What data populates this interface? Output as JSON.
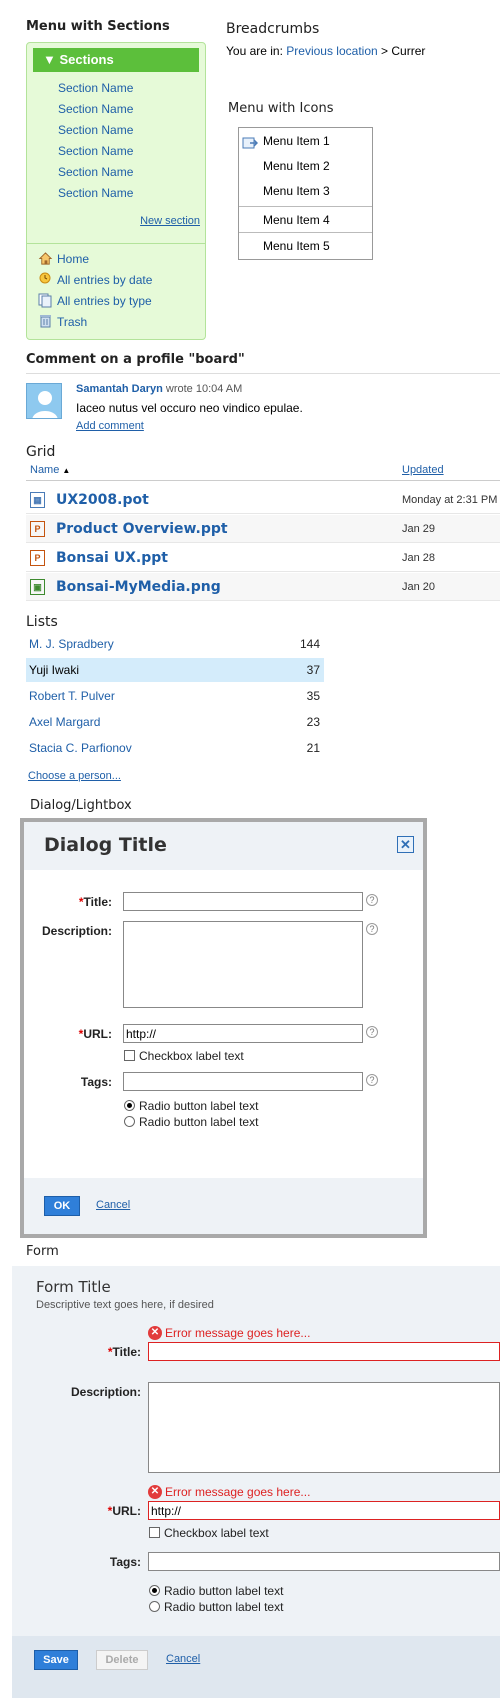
{
  "menu_sections": {
    "heading": "Menu with Sections",
    "header": "Sections",
    "items": [
      "Section Name",
      "Section Name",
      "Section Name",
      "Section Name",
      "Section Name",
      "Section Name"
    ],
    "new_section": "New section",
    "nav": [
      {
        "icon": "home-icon",
        "label": "Home"
      },
      {
        "icon": "clock-icon",
        "label": "All entries by date"
      },
      {
        "icon": "document-stack-icon",
        "label": "All entries by type"
      },
      {
        "icon": "trash-icon",
        "label": "Trash"
      }
    ]
  },
  "breadcrumbs": {
    "heading": "Breadcrumbs",
    "prefix": "You are in:",
    "previous": "Previous location",
    "separator": ">",
    "current": "Currer"
  },
  "menu_icons": {
    "heading": "Menu with Icons",
    "items": [
      "Menu Item 1",
      "Menu Item 2",
      "Menu Item 3",
      "Menu Item 4",
      "Menu Item 5"
    ]
  },
  "comment": {
    "heading": "Comment on a profile \"board\"",
    "author": "Samantah Daryn",
    "meta": "wrote 10:04 AM",
    "text": "Iaceo nutus vel occuro neo vindico epulae.",
    "add": "Add comment"
  },
  "grid": {
    "heading": "Grid",
    "col_name": "Name",
    "col_updated": "Updated",
    "rows": [
      {
        "name": "UX2008.pot",
        "date": "Monday at 2:31 PM",
        "icon": "calendar-file-icon"
      },
      {
        "name": "Product Overview.ppt",
        "date": "Jan 29",
        "icon": "powerpoint-file-icon"
      },
      {
        "name": "Bonsai UX.ppt",
        "date": "Jan 28",
        "icon": "powerpoint-file-icon"
      },
      {
        "name": "Bonsai-MyMedia.png",
        "date": "Jan 20",
        "icon": "image-file-icon"
      }
    ]
  },
  "lists": {
    "heading": "Lists",
    "rows": [
      {
        "name": "M. J. Spradbery",
        "count": "144"
      },
      {
        "name": "Yuji Iwaki",
        "count": "37"
      },
      {
        "name": "Robert T. Pulver",
        "count": "35"
      },
      {
        "name": "Axel Margard",
        "count": "23"
      },
      {
        "name": "Stacia C. Parfionov",
        "count": "21"
      }
    ],
    "selected_index": 1,
    "choose": "Choose a person..."
  },
  "dialog": {
    "heading": "Dialog/Lightbox",
    "title": "Dialog Title",
    "title_label": "Title:",
    "description_label": "Description:",
    "url_label": "URL:",
    "url_value": "http://",
    "checkbox_label": "Checkbox label text",
    "tags_label": "Tags:",
    "radio1": "Radio button label text",
    "radio2": "Radio button label text",
    "ok": "OK",
    "cancel": "Cancel"
  },
  "form": {
    "heading": "Form",
    "title": "Form Title",
    "description_text": "Descriptive text goes here, if desired",
    "error1": "Error message goes here...",
    "title_label": "Title:",
    "description_label": "Description:",
    "error2": "Error message goes here...",
    "url_label": "URL:",
    "url_value": "http://",
    "checkbox_label": "Checkbox label text",
    "tags_label": "Tags:",
    "radio1": "Radio button label text",
    "radio2": "Radio button label text",
    "save": "Save",
    "delete": "Delete",
    "cancel": "Cancel"
  },
  "colors": {
    "link": "#1f5fa8",
    "menu_green": "#5cbf3b",
    "menu_bg": "#e6fad8",
    "selected_row": "#d4ecfb",
    "error": "#d22",
    "button_blue": "#2f7fd9"
  }
}
